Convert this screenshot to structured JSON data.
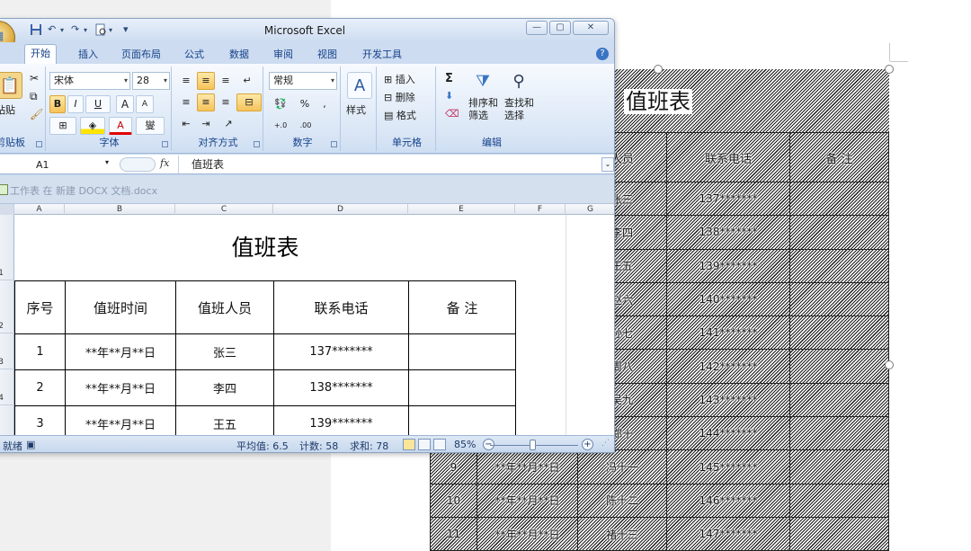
{
  "word_doc": {
    "table_title": "值班表",
    "headers": [
      "人员",
      "联系电话",
      "备  注"
    ],
    "rows": [
      {
        "num": "",
        "date": "",
        "name": "张三",
        "phone": "137*******",
        "note": ""
      },
      {
        "num": "",
        "date": "",
        "name": "李四",
        "phone": "138*******",
        "note": ""
      },
      {
        "num": "",
        "date": "",
        "name": "王五",
        "phone": "139*******",
        "note": ""
      },
      {
        "num": "",
        "date": "",
        "name": "赵六",
        "phone": "140*******",
        "note": ""
      },
      {
        "num": "",
        "date": "",
        "name": "孙七",
        "phone": "141*******",
        "note": ""
      },
      {
        "num": "",
        "date": "",
        "name": "周八",
        "phone": "142*******",
        "note": ""
      },
      {
        "num": "",
        "date": "",
        "name": "吴九",
        "phone": "143*******",
        "note": ""
      },
      {
        "num": "",
        "date": "",
        "name": "郑十",
        "phone": "144*******",
        "note": ""
      },
      {
        "num": "9",
        "date": "**年**月**日",
        "name": "冯十一",
        "phone": "145*******",
        "note": ""
      },
      {
        "num": "10",
        "date": "**年**月**日",
        "name": "陈十二",
        "phone": "146*******",
        "note": ""
      },
      {
        "num": "11",
        "date": "**年**月**日",
        "name": "褚十三",
        "phone": "147*******",
        "note": ""
      }
    ]
  },
  "excel": {
    "window_title": "Microsoft Excel",
    "qat": {
      "undo": "↶",
      "redo": "↷",
      "customize": "▾"
    },
    "window_buttons": {
      "minimize": "—",
      "restore": "▢",
      "close": "✕"
    },
    "tabs": [
      "开始",
      "插入",
      "页面布局",
      "公式",
      "数据",
      "审阅",
      "视图",
      "开发工具"
    ],
    "active_tab": "开始",
    "help": "?",
    "ribbon": {
      "clipboard": {
        "label": "剪贴板",
        "paste": "粘贴"
      },
      "font": {
        "label": "字体",
        "font_name": "宋体",
        "font_size": "28",
        "bold": "B",
        "italic": "I",
        "underline": "U",
        "grow": "A",
        "shrink": "A",
        "font_color": "A",
        "wen": "燮"
      },
      "alignment": {
        "label": "对齐方式"
      },
      "number": {
        "label": "数字",
        "format": "常规",
        "percent": "%",
        "comma": ",",
        "inc_decimal": "+.0",
        "dec_decimal": ".00"
      },
      "styles": {
        "label": "样式"
      },
      "cells": {
        "label": "单元格",
        "insert": "插入",
        "delete": "删除",
        "format": "格式"
      },
      "editing": {
        "label": "编辑",
        "sum": "Σ",
        "sort_filter": "排序和\n筛选",
        "find_select": "查找和\n选择"
      }
    },
    "name_box": "A1",
    "fx": "fx",
    "formula_value": "值班表",
    "workbook_title": "工作表 在 新建 DOCX 文档.docx",
    "columns": [
      "A",
      "B",
      "C",
      "D",
      "E",
      "F",
      "G"
    ],
    "row_numbers": [
      "1",
      "2",
      "3",
      "4"
    ],
    "sheet_title": "值班表",
    "table_headers": [
      "序号",
      "值班时间",
      "值班人员",
      "联系电话",
      "备  注"
    ],
    "table_rows": [
      {
        "num": "1",
        "date": "**年**月**日",
        "name": "张三",
        "phone": "137*******",
        "note": ""
      },
      {
        "num": "2",
        "date": "**年**月**日",
        "name": "李四",
        "phone": "138*******",
        "note": ""
      },
      {
        "num": "3",
        "date": "**年**月**日",
        "name": "王五",
        "phone": "139*******",
        "note": ""
      }
    ],
    "status": {
      "mode": "就绪",
      "average": "平均值: 6.5",
      "count": "计数: 58",
      "sum": "求和: 78",
      "zoom": "85%",
      "zoom_out": "−",
      "zoom_in": "+"
    }
  }
}
